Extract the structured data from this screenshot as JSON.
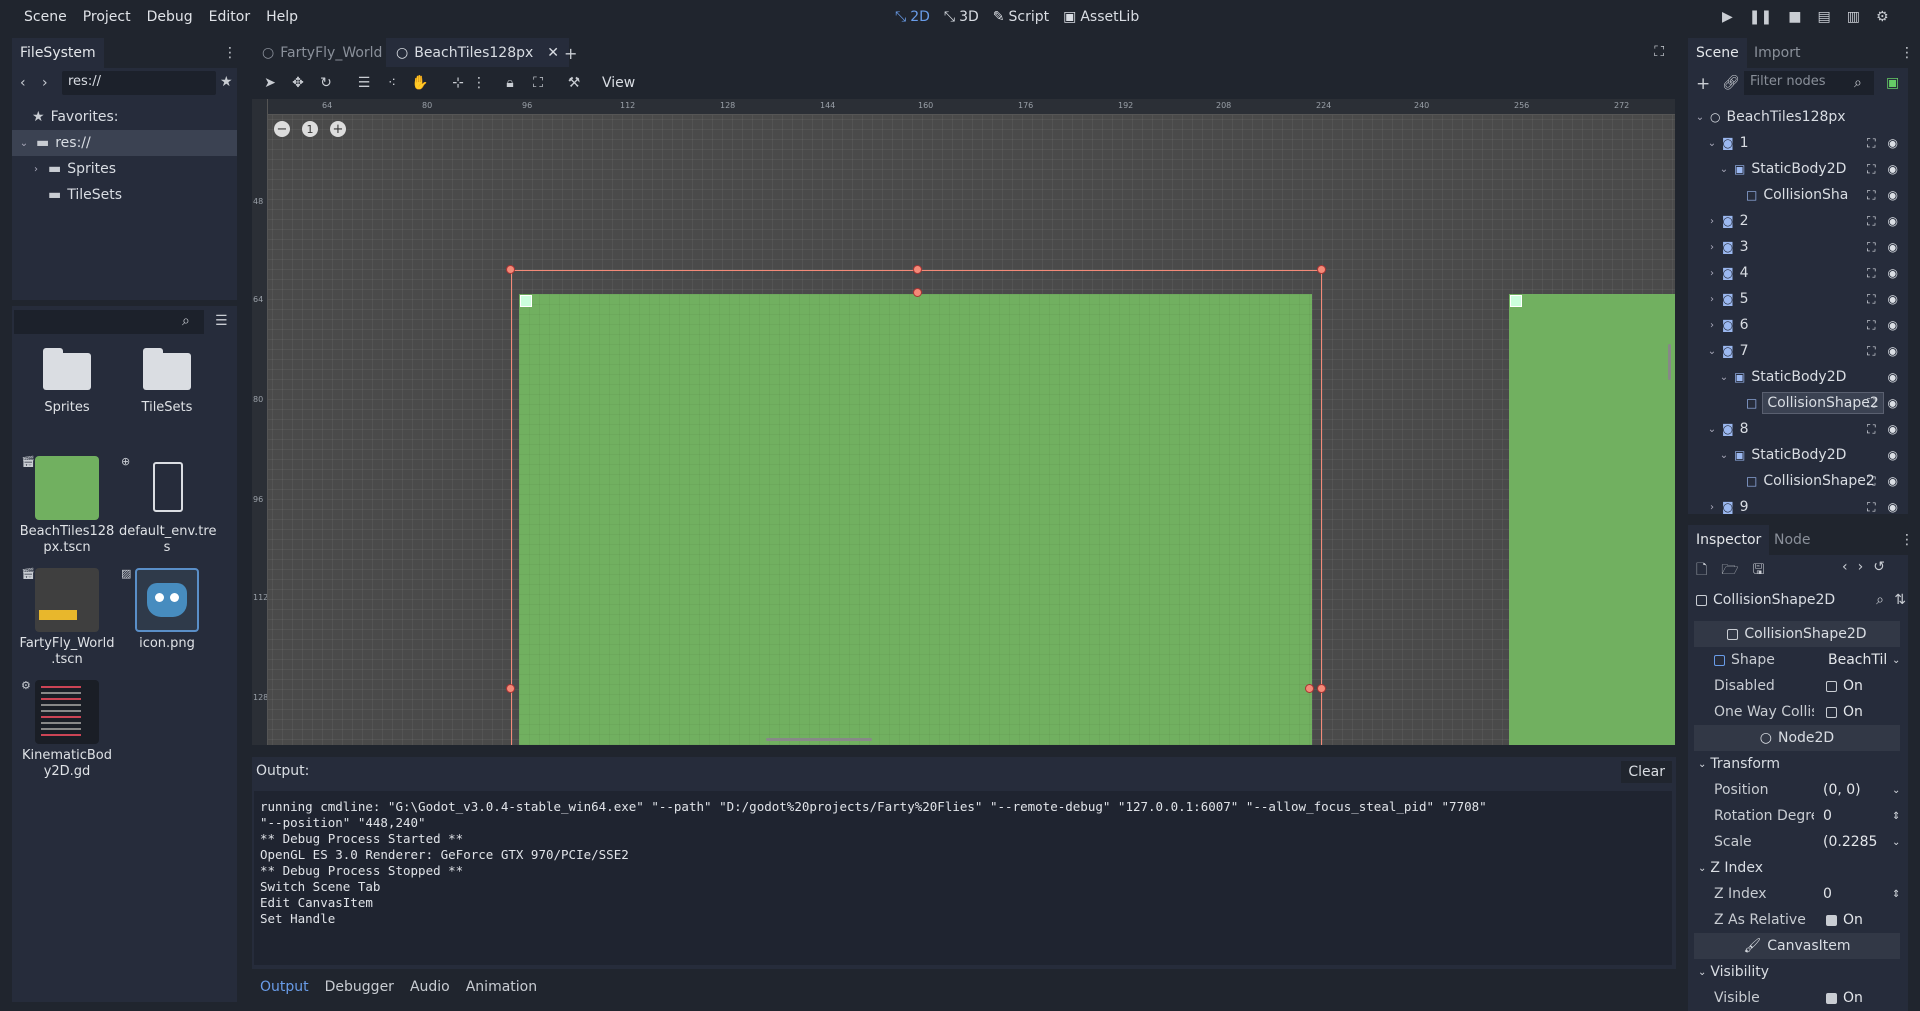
{
  "menu": {
    "items": [
      "Scene",
      "Project",
      "Debug",
      "Editor",
      "Help"
    ]
  },
  "modes": {
    "d2": "2D",
    "d3": "3D",
    "script": "Script",
    "assetlib": "AssetLib"
  },
  "filesystem": {
    "tab": "FileSystem",
    "path": "res://",
    "favorites": "Favorites:",
    "tree": [
      "res://",
      "Sprites",
      "TileSets"
    ],
    "files": [
      {
        "name": "Sprites",
        "type": "folder"
      },
      {
        "name": "TileSets",
        "type": "folder"
      },
      {
        "name": "BeachTiles128px.tscn",
        "line1": "BeachTiles128",
        "line2": "px.tscn",
        "type": "scene"
      },
      {
        "name": "default_env.tres",
        "line1": "default_env.tre",
        "line2": "s",
        "type": "resource"
      },
      {
        "name": "FartyFly_World.tscn",
        "line1": "FartyFly_World",
        "line2": ".tscn",
        "type": "scene"
      },
      {
        "name": "icon.png",
        "line1": "icon.png",
        "line2": "",
        "type": "image"
      },
      {
        "name": "KinematicBody2D.gd",
        "line1": "KinematicBod",
        "line2": "y2D.gd",
        "type": "script"
      }
    ]
  },
  "editor_tabs": {
    "tab1": "FartyFly_World",
    "tab2": "BeachTiles128px"
  },
  "toolbar": {
    "view": "View"
  },
  "ruler": {
    "h": [
      "64",
      "80",
      "96",
      "112",
      "128",
      "144",
      "160",
      "176",
      "192",
      "208",
      "224",
      "240",
      "256",
      "272"
    ],
    "v": [
      "48",
      "64",
      "80",
      "96",
      "112",
      "128"
    ]
  },
  "zoom": {
    "reset": "1"
  },
  "output": {
    "label": "Output:",
    "clear": "Clear",
    "lines": [
      "running cmdline: \"G:\\Godot_v3.0.4-stable_win64.exe\" \"--path\" \"D:/godot%20projects/Farty%20Flies\" \"--remote-debug\" \"127.0.0.1:6007\" \"--allow_focus_steal_pid\" \"7708\"",
      "\"--position\" \"448,240\"",
      "** Debug Process Started **",
      "OpenGL ES 3.0 Renderer: GeForce GTX 970/PCIe/SSE2",
      "** Debug Process Stopped **",
      "Switch Scene Tab",
      "Edit CanvasItem",
      "Set Handle"
    ],
    "tabs": [
      "Output",
      "Debugger",
      "Audio",
      "Animation"
    ]
  },
  "scene": {
    "tabs": [
      "Scene",
      "Import"
    ],
    "filter_placeholder": "Filter nodes",
    "nodes": [
      {
        "label": "BeachTiles128px",
        "depth": 0,
        "kind": "root"
      },
      {
        "label": "1",
        "depth": 1,
        "kind": "sprite"
      },
      {
        "label": "StaticBody2D",
        "depth": 2,
        "kind": "body"
      },
      {
        "label": "CollisionSha",
        "depth": 3,
        "kind": "shape"
      },
      {
        "label": "2",
        "depth": 1,
        "kind": "sprite"
      },
      {
        "label": "3",
        "depth": 1,
        "kind": "sprite"
      },
      {
        "label": "4",
        "depth": 1,
        "kind": "sprite"
      },
      {
        "label": "5",
        "depth": 1,
        "kind": "sprite"
      },
      {
        "label": "6",
        "depth": 1,
        "kind": "sprite"
      },
      {
        "label": "7",
        "depth": 1,
        "kind": "sprite"
      },
      {
        "label": "StaticBody2D",
        "depth": 2,
        "kind": "body"
      },
      {
        "label": "CollisionShape2",
        "depth": 3,
        "kind": "shape"
      },
      {
        "label": "8",
        "depth": 1,
        "kind": "sprite"
      },
      {
        "label": "StaticBody2D",
        "depth": 2,
        "kind": "body"
      },
      {
        "label": "CollisionShape2",
        "depth": 3,
        "kind": "shape"
      },
      {
        "label": "9",
        "depth": 1,
        "kind": "sprite"
      }
    ]
  },
  "inspector": {
    "tabs": [
      "Inspector",
      "Node"
    ],
    "object": "CollisionShape2D",
    "class_header": "CollisionShape2D",
    "shape_label": "Shape",
    "shape_value": "BeachTil",
    "disabled_label": "Disabled",
    "disabled_value": "On",
    "oneway_label": "One Way Collisi",
    "oneway_value": "On",
    "node2d_header": "Node2D",
    "transform_section": "Transform",
    "position_label": "Position",
    "position_value": "(0, 0)",
    "rotation_label": "Rotation Degre",
    "rotation_value": "0",
    "scale_label": "Scale",
    "scale_value": "(0.2285",
    "zindex_section": "Z Index",
    "zindex_label": "Z Index",
    "zindex_value": "0",
    "zrel_label": "Z As Relative",
    "zrel_value": "On",
    "canvasitem_header": "CanvasItem",
    "visibility_section": "Visibility",
    "visible_label": "Visible",
    "visible_value": "On"
  },
  "colors": {
    "accent": "#699ce8",
    "tile_green": "#71b060",
    "selection": "#f48a78"
  }
}
